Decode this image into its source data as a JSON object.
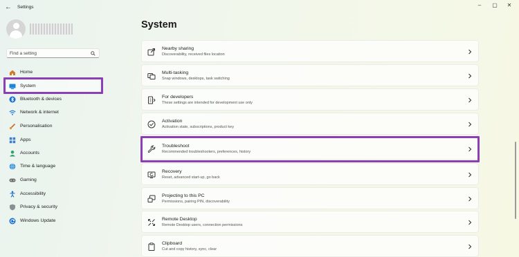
{
  "titlebar": {
    "back_glyph": "←",
    "title": "Settings",
    "minimize": "–",
    "maximize": "▢",
    "close": "✕"
  },
  "search": {
    "placeholder": "Find a setting"
  },
  "colors": {
    "highlight": "#8b3fb5",
    "accent": "#0067c0"
  },
  "sidebar": {
    "items": [
      {
        "label": "Home",
        "icon": "home-icon"
      },
      {
        "label": "System",
        "icon": "system-icon",
        "selected": true
      },
      {
        "label": "Bluetooth & devices",
        "icon": "bluetooth-icon"
      },
      {
        "label": "Network & internet",
        "icon": "wifi-icon"
      },
      {
        "label": "Personalisation",
        "icon": "brush-icon"
      },
      {
        "label": "Apps",
        "icon": "apps-icon"
      },
      {
        "label": "Accounts",
        "icon": "accounts-icon"
      },
      {
        "label": "Time & language",
        "icon": "globe-icon"
      },
      {
        "label": "Gaming",
        "icon": "gaming-icon"
      },
      {
        "label": "Accessibility",
        "icon": "accessibility-icon"
      },
      {
        "label": "Privacy & security",
        "icon": "shield-icon"
      },
      {
        "label": "Windows Update",
        "icon": "update-icon"
      }
    ]
  },
  "main": {
    "title": "System",
    "cards": [
      {
        "title": "Nearby sharing",
        "subtitle": "Discoverability, received files location",
        "icon": "share-icon"
      },
      {
        "title": "Multi-tasking",
        "subtitle": "Snap windows, desktops, task switching",
        "icon": "multitasking-icon"
      },
      {
        "title": "For developers",
        "subtitle": "These settings are intended for development use only",
        "icon": "developer-icon"
      },
      {
        "title": "Activation",
        "subtitle": "Activation state, subscriptions, product key",
        "icon": "activation-icon"
      },
      {
        "title": "Troubleshoot",
        "subtitle": "Recommended troubleshooters, preferences, history",
        "icon": "wrench-icon",
        "highlighted": true
      },
      {
        "title": "Recovery",
        "subtitle": "Reset, advanced start-up, go back",
        "icon": "recovery-icon"
      },
      {
        "title": "Projecting to this PC",
        "subtitle": "Permissions, pairing PIN, discoverability",
        "icon": "projecting-icon"
      },
      {
        "title": "Remote Desktop",
        "subtitle": "Remote Desktop users, connection permissions",
        "icon": "remote-desktop-icon"
      },
      {
        "title": "Clipboard",
        "subtitle": "Cut and copy history, sync, clear",
        "icon": "clipboard-icon"
      }
    ]
  }
}
